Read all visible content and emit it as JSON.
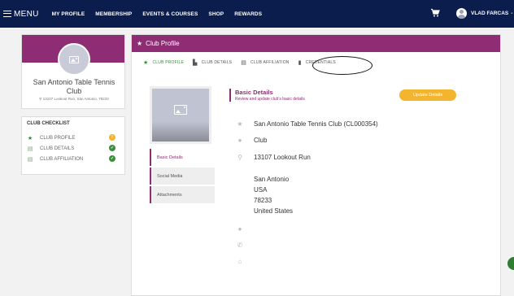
{
  "nav": {
    "menu_label": "MENU",
    "links": [
      "MY PROFILE",
      "MEMBERSHIP",
      "EVENTS & COURSES",
      "SHOP",
      "REWARDS"
    ],
    "user_name": "VLAD FARCAS",
    "caret": "-"
  },
  "profile": {
    "club_name": "San Antonio Table Tennis Club",
    "address": "13107 Lookout Run, San Antonio, 78233"
  },
  "checklist": {
    "title": "CLUB CHECKLIST",
    "items": [
      {
        "label": "CLUB PROFILE",
        "status": "!"
      },
      {
        "label": "CLUB DETAILS",
        "status": "✓"
      },
      {
        "label": "CLUB AFFILIATION",
        "status": "✓"
      }
    ]
  },
  "main": {
    "title": "Club Profile",
    "tabs": [
      "CLUB PROFILE",
      "CLUB DETAILS",
      "CLUB AFFILIATION",
      "CREDENTIALS"
    ],
    "side_nav": [
      "Basic Details",
      "Social Media",
      "Attachments"
    ],
    "section_title": "Basic Details",
    "section_subtitle": "Review and update club's basic details",
    "update_button": "Update Details",
    "club_line": "San Antonio Table Tennis Club (CL000354)",
    "club_type": "Club",
    "street": "13107 Lookout Run",
    "city": "San Antonio",
    "country_code": "USA",
    "zip": "78233",
    "country": "United States"
  },
  "colors": {
    "nav_bg": "#0b1d4d",
    "accent": "#8e2d73",
    "button": "#f3b52d",
    "active_tab": "#2f8f2f"
  }
}
